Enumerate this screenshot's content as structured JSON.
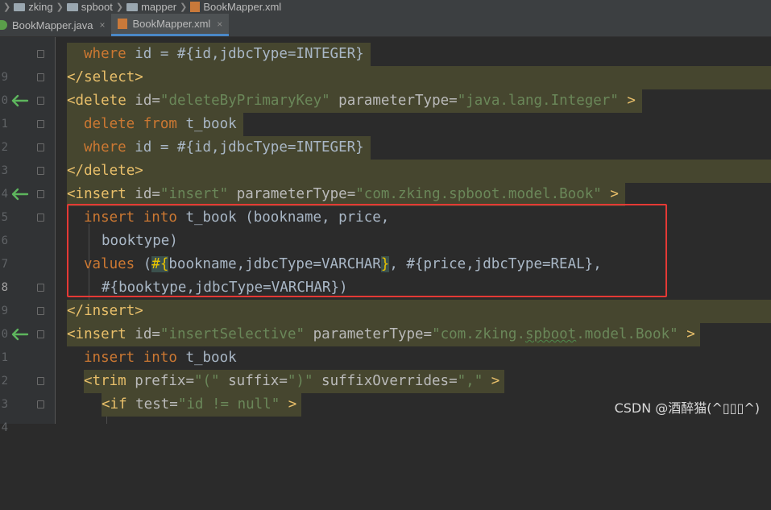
{
  "breadcrumb": [
    "zking",
    "spboot",
    "mapper",
    "BookMapper.xml"
  ],
  "tabs": [
    {
      "label": "BookMapper.java",
      "active": false
    },
    {
      "label": "BookMapper.xml",
      "active": true
    }
  ],
  "tab_close_glyph": "×",
  "line_numbers": [
    "9",
    "0",
    "1",
    "2",
    "3",
    "4",
    "5",
    "6",
    "7",
    "8",
    "9",
    "0",
    "1",
    "2",
    "3",
    "4"
  ],
  "code": {
    "l1": {
      "kw": "where",
      "txt": " id = #{id,jdbcType=INTEGER}"
    },
    "l2": {
      "tag": "</select>"
    },
    "l3": {
      "tag_open": "<delete",
      "attr1": " id=",
      "val1": "\"deleteByPrimaryKey\"",
      "attr2": " parameterType=",
      "val2": "\"java.lang.Integer\"",
      "tag_close": " >"
    },
    "l4": {
      "kw": "delete from",
      "txt": " t_book"
    },
    "l5": {
      "kw": "where",
      "txt": " id = #{id,jdbcType=INTEGER}"
    },
    "l6": {
      "tag": "</delete>"
    },
    "l7": {
      "tag_open": "<insert",
      "attr1": " id=",
      "val1": "\"insert\"",
      "attr2": " parameterType=",
      "val2": "\"com.zking.spboot.model.Book\"",
      "tag_close": " >"
    },
    "l8": {
      "kw": "insert into",
      "txt": " t_book (bookname, price,"
    },
    "l9": {
      "txt": "booktype)"
    },
    "l10": {
      "kw": "values",
      "pre": " (",
      "brace_open": "#{",
      "mid": "bookname,jdbcType=VARCHAR",
      "brace_close": "}",
      "txt": ", #{price,jdbcType=REAL},"
    },
    "l11": {
      "txt": "#{booktype,jdbcType=VARCHAR})"
    },
    "l12": {
      "tag": "</insert>"
    },
    "l13": {
      "tag_open": "<insert",
      "attr1": " id=",
      "val1": "\"insertSelective\"",
      "attr2": " parameterType=",
      "val2_a": "\"com.zking.",
      "val2_b": "spboot",
      "val2_c": ".model.Book\"",
      "tag_close": " >"
    },
    "l14": {
      "kw": "insert into",
      "txt": " t_book"
    },
    "l15": {
      "tag_open": "<trim",
      "attr1": " prefix=",
      "val1": "\"(\"",
      "attr2": " suffix=",
      "val2": "\")\"",
      "attr3": " suffixOverrides=",
      "val3": "\",\"",
      "tag_close": " >"
    },
    "l16": {
      "tag_open": "<if",
      "attr1": " test=",
      "val1": "\"id != null\"",
      "tag_close": " >"
    }
  },
  "watermark": "CSDN @酒醉猫(^▯▯▯^)",
  "colors": {
    "background": "#2b2b2b",
    "tag": "#e8bf6a",
    "keyword": "#cc7832",
    "string": "#6a8759",
    "text": "#a9b7c6",
    "highlight_band": "#46462f",
    "selection_box": "#e53935",
    "arrow": "#5db55d"
  }
}
